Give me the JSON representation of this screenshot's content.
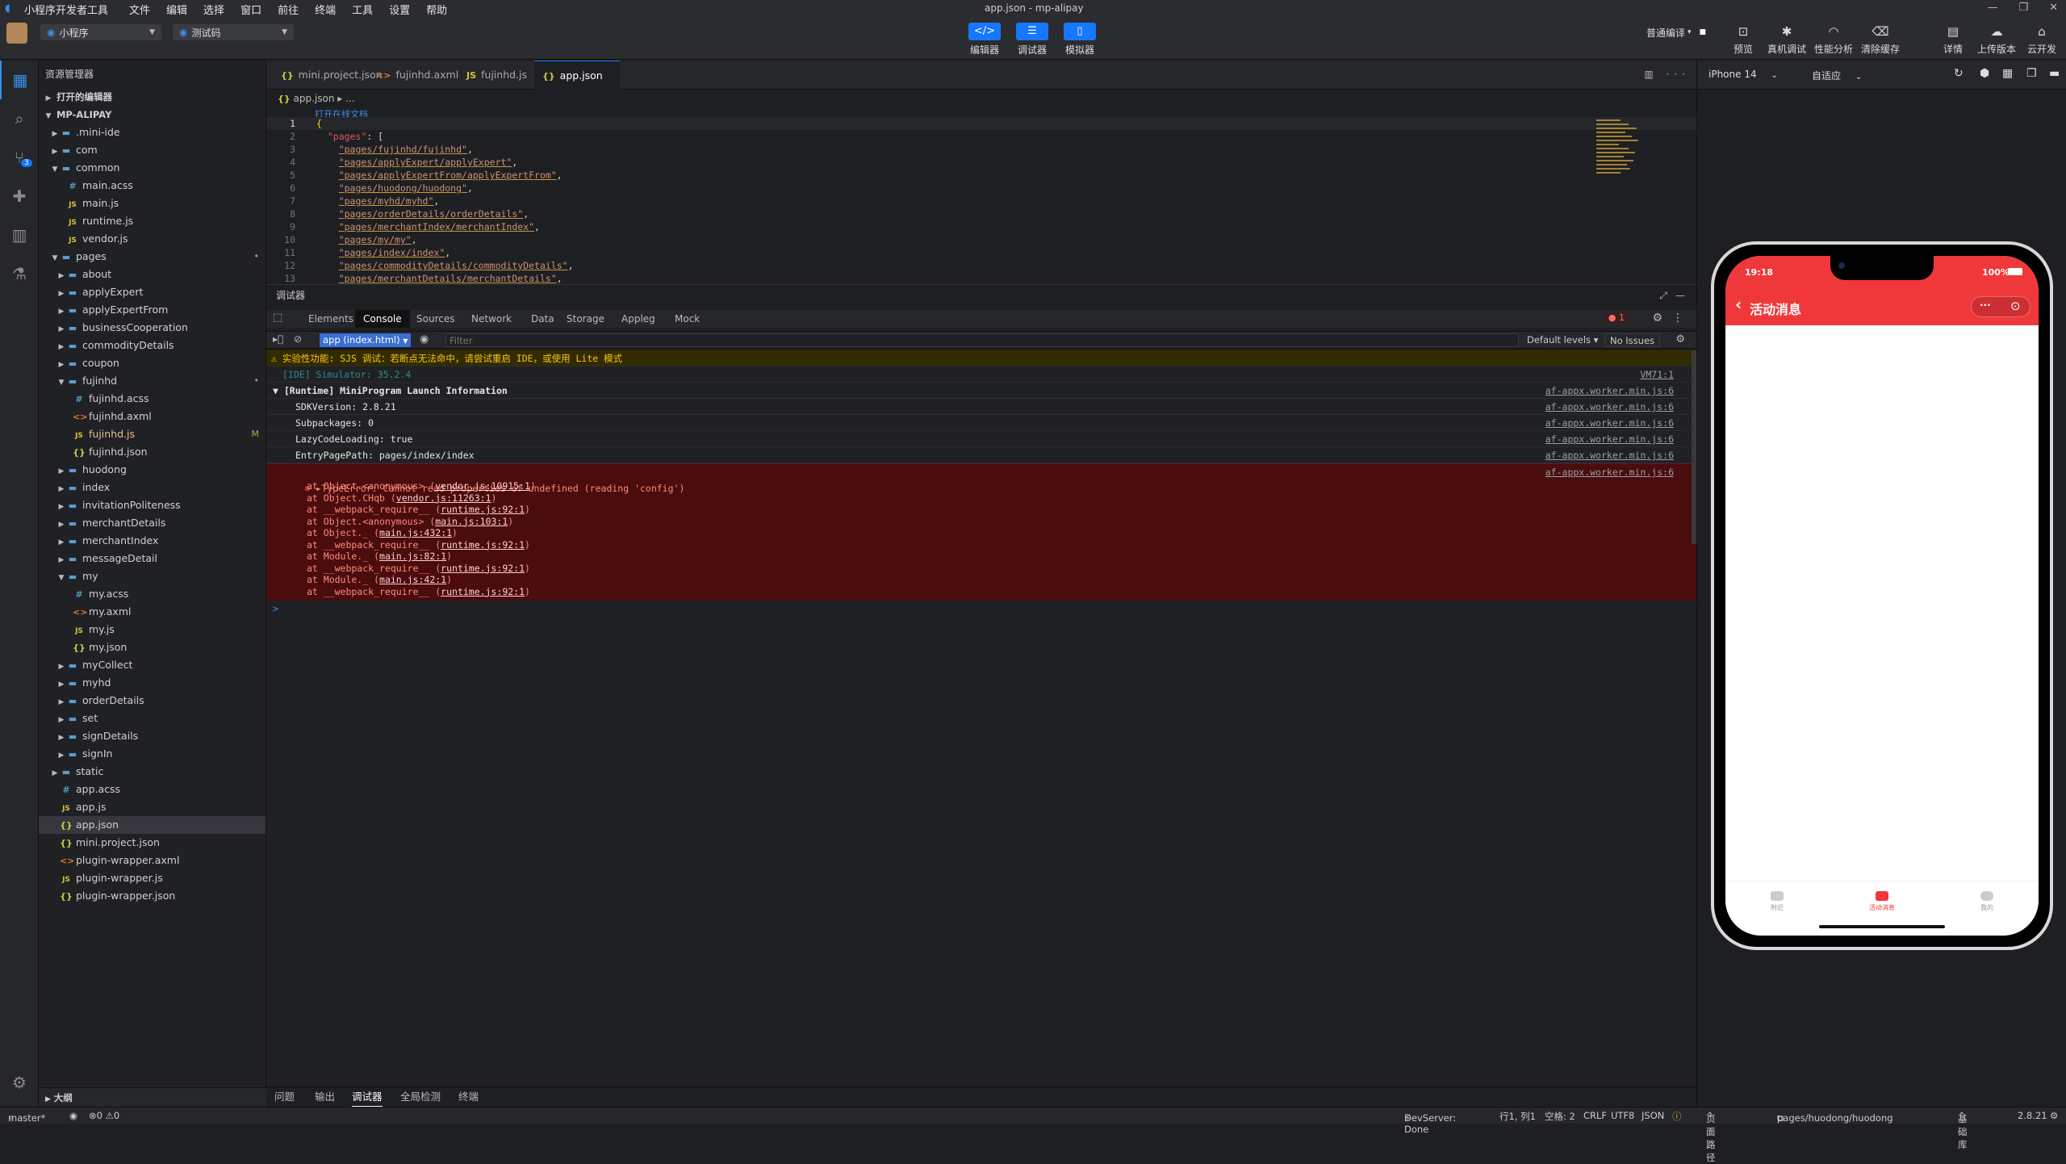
{
  "titlebar": {
    "app_name": "小程序开发者工具",
    "menu": [
      "文件",
      "编辑",
      "选择",
      "窗口",
      "前往",
      "终端",
      "工具",
      "设置",
      "帮助"
    ],
    "window_title": "app.json - mp-alipay"
  },
  "toolbar": {
    "mode_select": "小程序",
    "env_select": "测试码",
    "center_buttons": [
      "编辑器",
      "调试器",
      "模拟器"
    ],
    "compile_select": "普通编译",
    "right_buttons": [
      "预览",
      "真机调试",
      "性能分析",
      "清除缓存",
      "详情",
      "上传版本",
      "云开发"
    ]
  },
  "activity": {
    "git_badge": "3"
  },
  "explorer": {
    "title": "资源管理器",
    "open_editors": "打开的编辑器",
    "root": "MP-ALIPAY",
    "outline": "大纲",
    "tree": [
      {
        "depth": 1,
        "type": "folder",
        "name": ".mini-ide",
        "open": false
      },
      {
        "depth": 1,
        "type": "folder",
        "name": "com",
        "open": false
      },
      {
        "depth": 1,
        "type": "folder",
        "name": "common",
        "open": true
      },
      {
        "depth": 2,
        "type": "css",
        "name": "main.acss"
      },
      {
        "depth": 2,
        "type": "js",
        "name": "main.js"
      },
      {
        "depth": 2,
        "type": "js",
        "name": "runtime.js"
      },
      {
        "depth": 2,
        "type": "js",
        "name": "vendor.js"
      },
      {
        "depth": 1,
        "type": "folder",
        "name": "pages",
        "open": true,
        "dot": "•"
      },
      {
        "depth": 2,
        "type": "folder",
        "name": "about",
        "open": false
      },
      {
        "depth": 2,
        "type": "folder",
        "name": "applyExpert",
        "open": false
      },
      {
        "depth": 2,
        "type": "folder",
        "name": "applyExpertFrom",
        "open": false
      },
      {
        "depth": 2,
        "type": "folder",
        "name": "businessCooperation",
        "open": false
      },
      {
        "depth": 2,
        "type": "folder",
        "name": "commodityDetails",
        "open": false
      },
      {
        "depth": 2,
        "type": "folder",
        "name": "coupon",
        "open": false
      },
      {
        "depth": 2,
        "type": "folder",
        "name": "fujinhd",
        "open": true,
        "dot": "•"
      },
      {
        "depth": 3,
        "type": "css",
        "name": "fujinhd.acss"
      },
      {
        "depth": 3,
        "type": "xml",
        "name": "fujinhd.axml"
      },
      {
        "depth": 3,
        "type": "js",
        "name": "fujinhd.js",
        "mark": "M",
        "modified": true
      },
      {
        "depth": 3,
        "type": "json",
        "name": "fujinhd.json"
      },
      {
        "depth": 2,
        "type": "folder",
        "name": "huodong",
        "open": false
      },
      {
        "depth": 2,
        "type": "folder",
        "name": "index",
        "open": false
      },
      {
        "depth": 2,
        "type": "folder",
        "name": "invitationPoliteness",
        "open": false
      },
      {
        "depth": 2,
        "type": "folder",
        "name": "merchantDetails",
        "open": false
      },
      {
        "depth": 2,
        "type": "folder",
        "name": "merchantIndex",
        "open": false
      },
      {
        "depth": 2,
        "type": "folder",
        "name": "messageDetail",
        "open": false
      },
      {
        "depth": 2,
        "type": "folder",
        "name": "my",
        "open": true
      },
      {
        "depth": 3,
        "type": "css",
        "name": "my.acss"
      },
      {
        "depth": 3,
        "type": "xml",
        "name": "my.axml"
      },
      {
        "depth": 3,
        "type": "js",
        "name": "my.js"
      },
      {
        "depth": 3,
        "type": "json",
        "name": "my.json"
      },
      {
        "depth": 2,
        "type": "folder",
        "name": "myCollect",
        "open": false
      },
      {
        "depth": 2,
        "type": "folder",
        "name": "myhd",
        "open": false
      },
      {
        "depth": 2,
        "type": "folder",
        "name": "orderDetails",
        "open": false
      },
      {
        "depth": 2,
        "type": "folder",
        "name": "set",
        "open": false
      },
      {
        "depth": 2,
        "type": "folder",
        "name": "signDetails",
        "open": false
      },
      {
        "depth": 2,
        "type": "folder",
        "name": "signIn",
        "open": false
      },
      {
        "depth": 1,
        "type": "folder",
        "name": "static",
        "open": false
      },
      {
        "depth": 1,
        "type": "css",
        "name": "app.acss"
      },
      {
        "depth": 1,
        "type": "js",
        "name": "app.js"
      },
      {
        "depth": 1,
        "type": "json",
        "name": "app.json",
        "active": true
      },
      {
        "depth": 1,
        "type": "json",
        "name": "mini.project.json"
      },
      {
        "depth": 1,
        "type": "xml",
        "name": "plugin-wrapper.axml"
      },
      {
        "depth": 1,
        "type": "js",
        "name": "plugin-wrapper.js"
      },
      {
        "depth": 1,
        "type": "json",
        "name": "plugin-wrapper.json"
      }
    ]
  },
  "editor": {
    "tabs": [
      {
        "type": "json",
        "name": "mini.project.json"
      },
      {
        "type": "xml",
        "name": "fujinhd.axml"
      },
      {
        "type": "js",
        "name": "fujinhd.js"
      },
      {
        "type": "json",
        "name": "app.json",
        "active": true
      }
    ],
    "breadcrumb_file": "app.json",
    "breadcrumb_rest": "▸ ...",
    "codelens": "打开在线文档",
    "lines": [
      {
        "n": "1",
        "text": "{"
      },
      {
        "n": "2",
        "key": "\"pages\"",
        "rest": ": ["
      },
      {
        "n": "3",
        "str": "\"pages/fujinhd/fujinhd\"",
        "rest": ","
      },
      {
        "n": "4",
        "str": "\"pages/applyExpert/applyExpert\"",
        "rest": ","
      },
      {
        "n": "5",
        "str": "\"pages/applyExpertFrom/applyExpertFrom\"",
        "rest": ","
      },
      {
        "n": "6",
        "str": "\"pages/huodong/huodong\"",
        "rest": ","
      },
      {
        "n": "7",
        "str": "\"pages/myhd/myhd\"",
        "rest": ","
      },
      {
        "n": "8",
        "str": "\"pages/orderDetails/orderDetails\"",
        "rest": ","
      },
      {
        "n": "9",
        "str": "\"pages/merchantIndex/merchantIndex\"",
        "rest": ","
      },
      {
        "n": "10",
        "str": "\"pages/my/my\"",
        "rest": ","
      },
      {
        "n": "11",
        "str": "\"pages/index/index\"",
        "rest": ","
      },
      {
        "n": "12",
        "str": "\"pages/commodityDetails/commodityDetails\"",
        "rest": ","
      },
      {
        "n": "13",
        "str": "\"pages/merchantDetails/merchantDetails\"",
        "rest": ","
      }
    ]
  },
  "debugger": {
    "title": "调试器",
    "tabs": [
      "Elements",
      "Console",
      "Sources",
      "Network",
      "Data",
      "Storage",
      "Appleg",
      "Mock"
    ],
    "active_tab": "Console",
    "error_count": "1",
    "context": "app (index.html)",
    "filter_placeholder": "Filter",
    "levels": "Default levels",
    "issues": "No Issues",
    "warning": "⚠ 实验性功能: SJS 调试：若断点无法命中，请尝试重启 IDE，或使用 Lite 模式",
    "sim_line": "[IDE] Simulator: 35.2.4",
    "sim_src": "VM71:1",
    "launch_title": "▼ [Runtime] MiniProgram Launch Information",
    "launch_src": "af-appx.worker.min.js:6",
    "launch_items": [
      {
        "text": "SDKVersion: 2.8.21",
        "src": "af-appx.worker.min.js:6"
      },
      {
        "text": "Subpackages: 0",
        "src": "af-appx.worker.min.js:6"
      },
      {
        "text": "LazyCodeLoading: true",
        "src": "af-appx.worker.min.js:6"
      },
      {
        "text": "EntryPagePath: pages/index/index",
        "src": "af-appx.worker.min.js:6"
      }
    ],
    "error_title": "▸TypeError: Cannot read properties of undefined (reading 'config')",
    "error_src": "af-appx.worker.min.js:6",
    "stack": [
      {
        "pre": "at Object.<anonymous> (",
        "link": "vendor.js:10915:1",
        "post": ")"
      },
      {
        "pre": "at Object.CHqb (",
        "link": "vendor.js:11263:1",
        "post": ")"
      },
      {
        "pre": "at __webpack_require__ (",
        "link": "runtime.js:92:1",
        "post": ")"
      },
      {
        "pre": "at Object.<anonymous> (",
        "link": "main.js:103:1",
        "post": ")"
      },
      {
        "pre": "at Object._ (",
        "link": "main.js:432:1",
        "post": ")"
      },
      {
        "pre": "at __webpack_require__ (",
        "link": "runtime.js:92:1",
        "post": ")"
      },
      {
        "pre": "at Module._ (",
        "link": "main.js:82:1",
        "post": ")"
      },
      {
        "pre": "at __webpack_require__ (",
        "link": "runtime.js:92:1",
        "post": ")"
      },
      {
        "pre": "at Module._ (",
        "link": "main.js:42:1",
        "post": ")"
      },
      {
        "pre": "at __webpack_require__ (",
        "link": "runtime.js:92:1",
        "post": ")"
      }
    ],
    "prompt": ">"
  },
  "panel_tabs": [
    "问题",
    "输出",
    "调试器",
    "全局检测",
    "终端"
  ],
  "panel_active": "调试器",
  "simulator": {
    "device": "iPhone 14",
    "zoom": "自适应",
    "time": "19:18",
    "battery": "100%",
    "nav_title": "活动消息",
    "more": "···",
    "tabbar": [
      {
        "label": "附近"
      },
      {
        "label": "活动消息",
        "active": true
      },
      {
        "label": "我的"
      }
    ]
  },
  "statusbar": {
    "branch": "master*",
    "problems": "⊗0 ⚠0",
    "devserver": "DevServer: Done",
    "position": "行1, 列1",
    "spaces": "空格: 2",
    "eol": "CRLF",
    "encoding": "UTF8",
    "language": "JSON",
    "page_path_label": "页面路径",
    "page_path": "pages/huodong/huodong",
    "base_lib": "基础库",
    "version": "2.8.21"
  }
}
